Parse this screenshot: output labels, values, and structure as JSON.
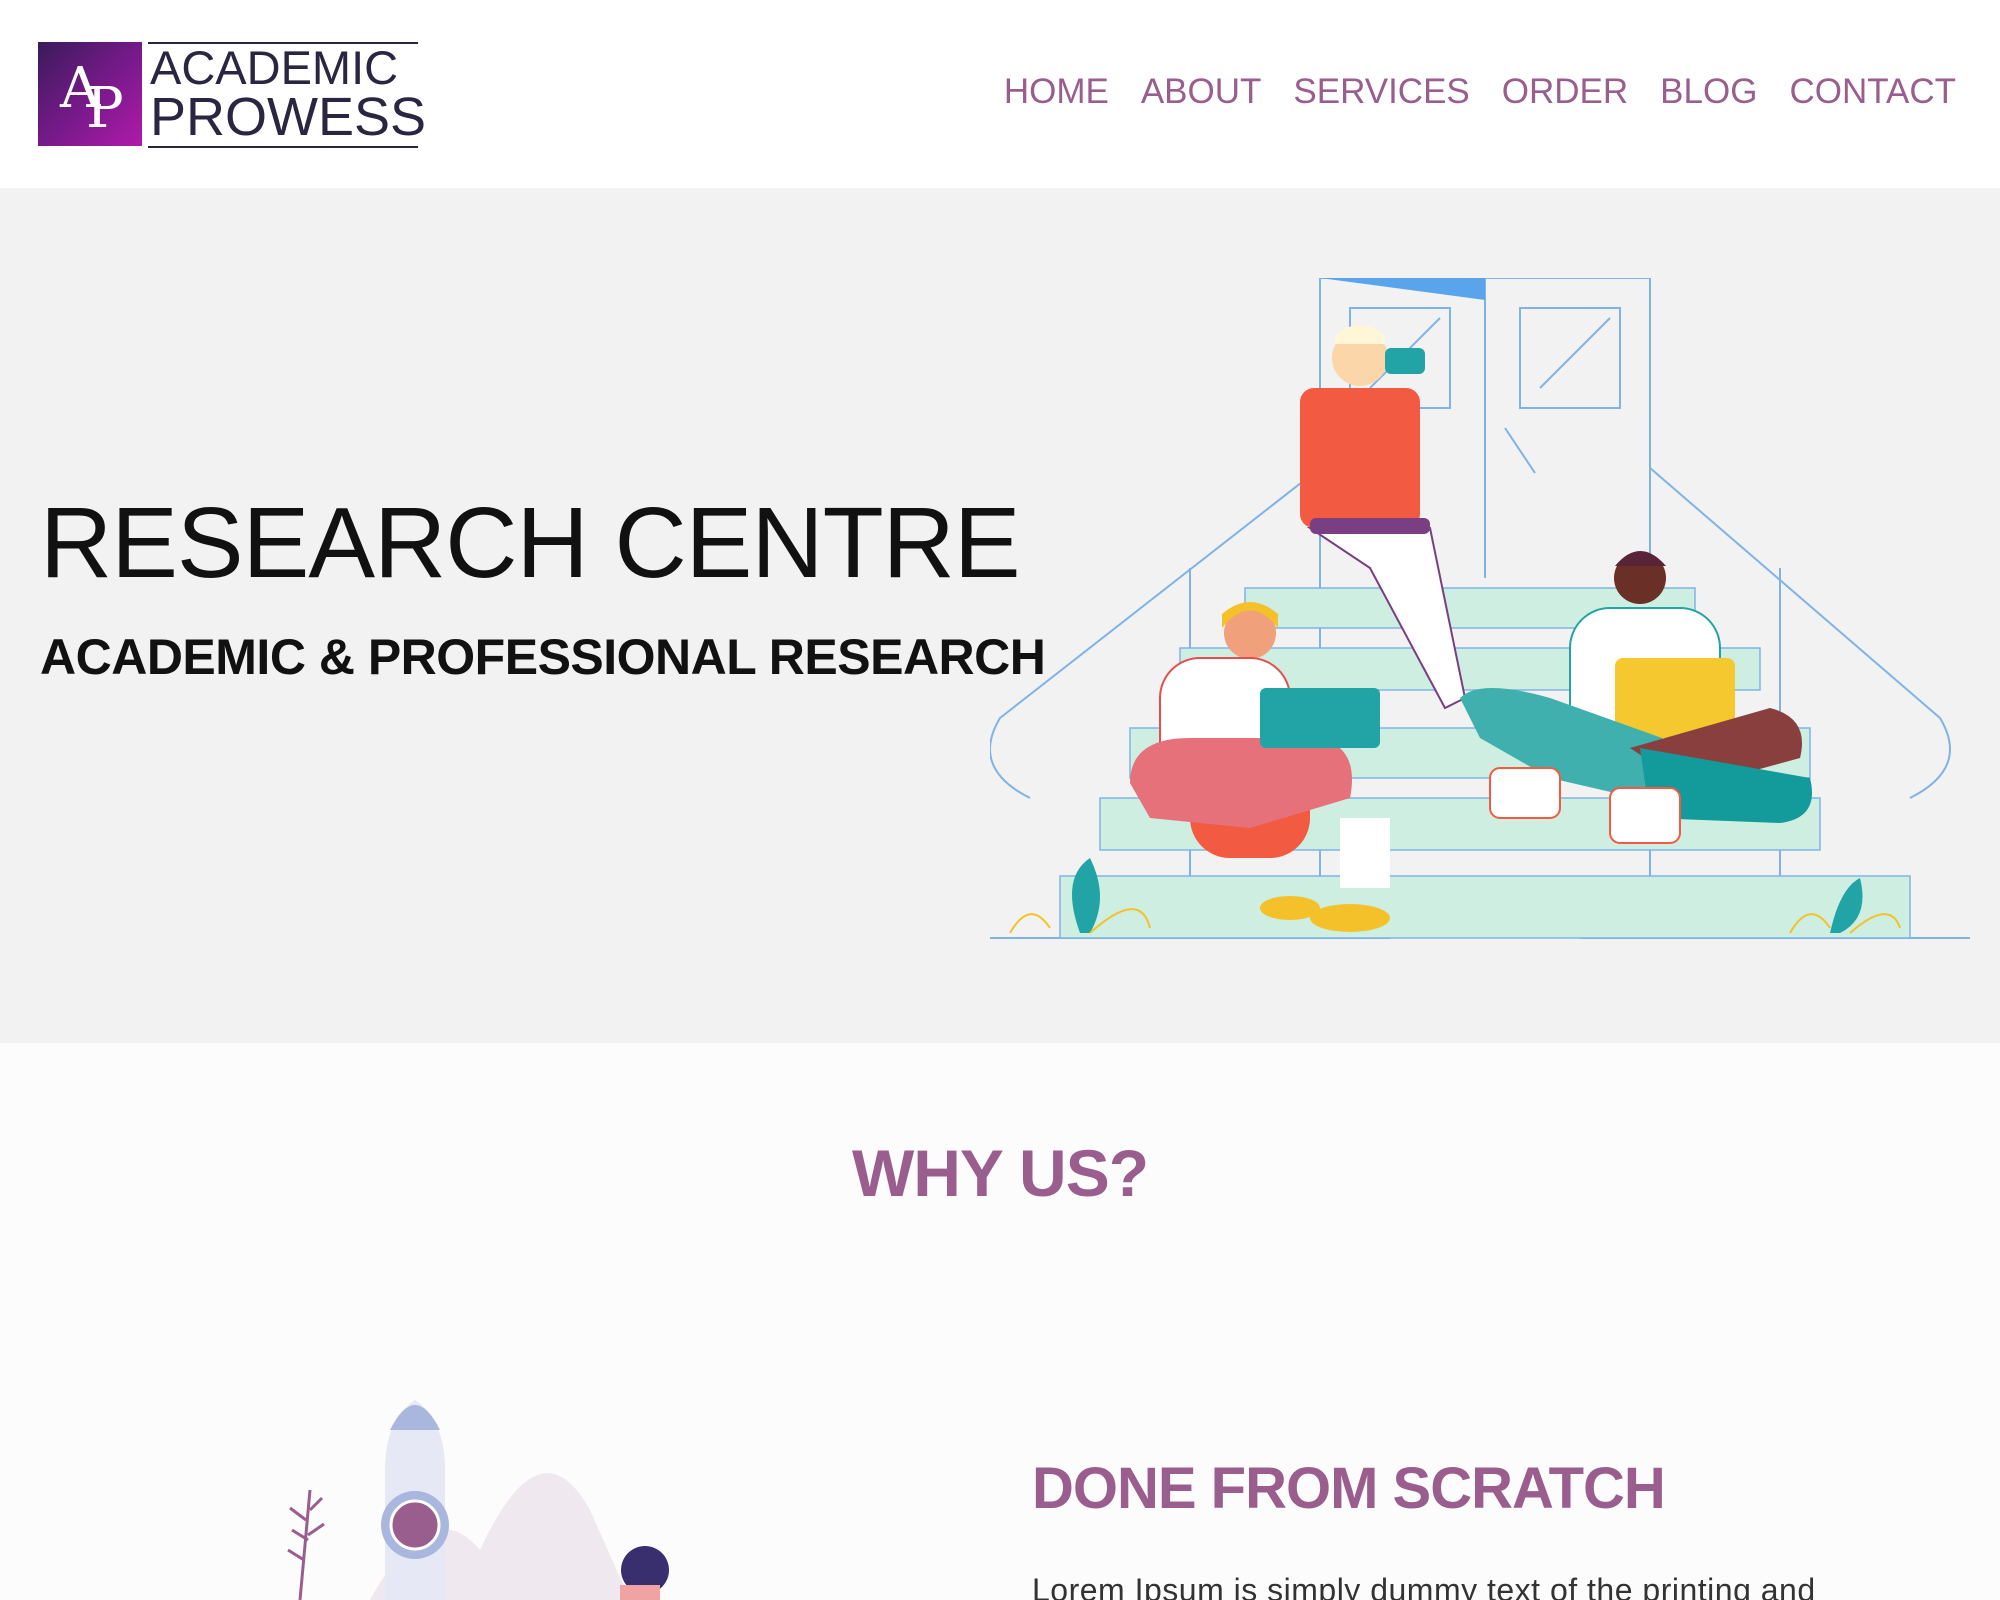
{
  "brand": {
    "monogram_a": "A",
    "monogram_p": "P",
    "word1": "ACADEMIC",
    "word2": "PROWESS"
  },
  "nav": {
    "items": [
      {
        "label": "HOME"
      },
      {
        "label": "ABOUT"
      },
      {
        "label": "SERVICES"
      },
      {
        "label": "ORDER"
      },
      {
        "label": "BLOG"
      },
      {
        "label": "CONTACT"
      }
    ]
  },
  "hero": {
    "title": "RESEARCH CENTRE",
    "subtitle": "ACADEMIC & PROFESSIONAL RESEARCH"
  },
  "why": {
    "title": "WHY US?"
  },
  "feature": {
    "title": "DONE FROM SCRATCH",
    "text": "Lorem Ipsum is simply dummy text of the printing and"
  },
  "colors": {
    "accent": "#9a5e8e",
    "hero_bg": "#f2f2f2",
    "logo_gradient_start": "#3a1a5a",
    "logo_gradient_end": "#b01aa8"
  }
}
